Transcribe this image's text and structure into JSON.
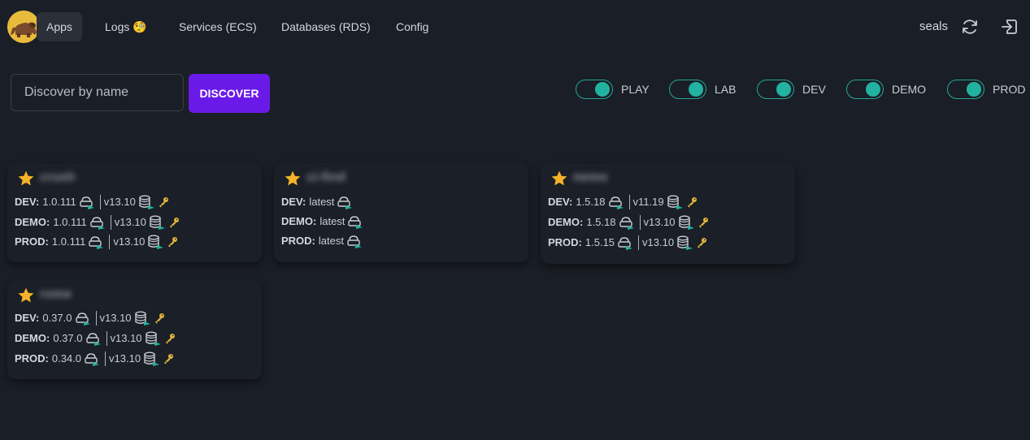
{
  "nav": {
    "logo_icon": "bear-logo-icon",
    "items": [
      {
        "label": "Apps",
        "active": true
      },
      {
        "label": "Logs 🧐",
        "active": false
      },
      {
        "label": "Services (ECS)",
        "active": false
      },
      {
        "label": "Databases (RDS)",
        "active": false
      },
      {
        "label": "Config",
        "active": false
      }
    ],
    "user": "seals",
    "refresh_icon": "refresh-icon",
    "logout_icon": "logout-icon"
  },
  "discover": {
    "placeholder": "Discover by name",
    "button_label": "DISCOVER",
    "button_color": "#6a1ae8"
  },
  "environments": [
    {
      "label": "PLAY",
      "enabled": true
    },
    {
      "label": "LAB",
      "enabled": true
    },
    {
      "label": "DEV",
      "enabled": true
    },
    {
      "label": "DEMO",
      "enabled": true
    },
    {
      "label": "PROD",
      "enabled": true
    }
  ],
  "accent_color": "#22b3a0",
  "apps": [
    {
      "name": "crush",
      "favorite": true,
      "rows": [
        {
          "env": "DEV:",
          "version": "1.0.111",
          "db_version": "v13.10",
          "has_db": true,
          "has_key": true
        },
        {
          "env": "DEMO:",
          "version": "1.0.111",
          "db_version": "v13.10",
          "has_db": true,
          "has_key": true
        },
        {
          "env": "PROD:",
          "version": "1.0.111",
          "db_version": "v13.10",
          "has_db": true,
          "has_key": true
        }
      ]
    },
    {
      "name": "ci-find",
      "favorite": true,
      "rows": [
        {
          "env": "DEV:",
          "version": "latest",
          "db_version": "",
          "has_db": false,
          "has_key": false
        },
        {
          "env": "DEMO:",
          "version": "latest",
          "db_version": "",
          "has_db": false,
          "has_key": false
        },
        {
          "env": "PROD:",
          "version": "latest",
          "db_version": "",
          "has_db": false,
          "has_key": false
        }
      ]
    },
    {
      "name": "nemo",
      "favorite": true,
      "rows": [
        {
          "env": "DEV:",
          "version": "1.5.18",
          "db_version": "v11.19",
          "has_db": true,
          "has_key": true
        },
        {
          "env": "DEMO:",
          "version": "1.5.18",
          "db_version": "v13.10",
          "has_db": true,
          "has_key": true
        },
        {
          "env": "PROD:",
          "version": "1.5.15",
          "db_version": "v13.10",
          "has_db": true,
          "has_key": true
        }
      ]
    },
    {
      "name": "rome",
      "favorite": true,
      "rows": [
        {
          "env": "DEV:",
          "version": "0.37.0",
          "db_version": "v13.10",
          "has_db": true,
          "has_key": true
        },
        {
          "env": "DEMO:",
          "version": "0.37.0",
          "db_version": "v13.10",
          "has_db": true,
          "has_key": true
        },
        {
          "env": "PROD:",
          "version": "0.34.0",
          "db_version": "v13.10",
          "has_db": true,
          "has_key": true
        }
      ]
    }
  ]
}
